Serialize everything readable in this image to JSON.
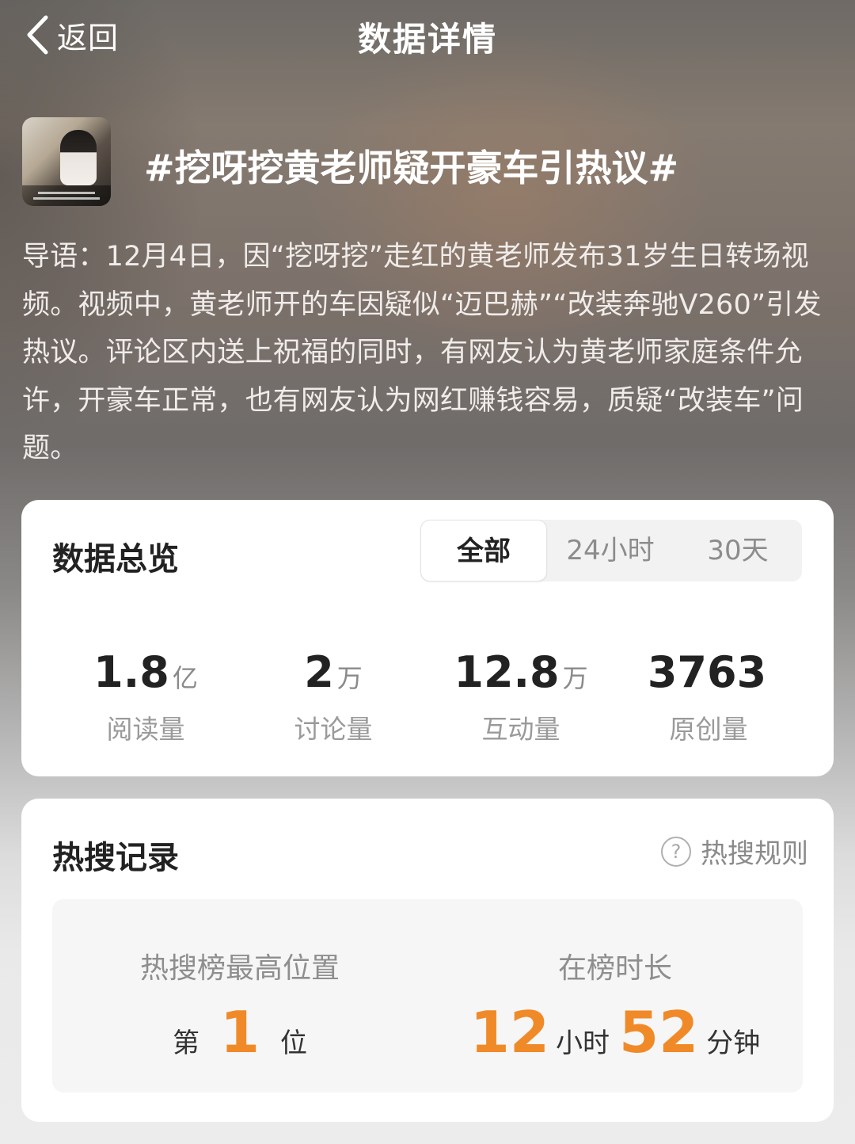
{
  "header": {
    "back_label": "返回",
    "title": "数据详情"
  },
  "topic": {
    "title": "#挖呀挖黄老师疑开豪车引热议#",
    "intro": "导语：12月4日，因“挖呀挖”走红的黄老师发布31岁生日转场视频。视频中，黄老师开的车因疑似“迈巴赫”“改装奔驰V260”引发热议。评论区内送上祝福的同时，有网友认为黄老师家庭条件允许，开豪车正常，也有网友认为网红赚钱容易，质疑“改装车”问题。"
  },
  "overview": {
    "title": "数据总览",
    "tabs": [
      {
        "label": "全部",
        "active": true
      },
      {
        "label": "24小时",
        "active": false
      },
      {
        "label": "30天",
        "active": false
      }
    ],
    "stats": [
      {
        "value": "1.8",
        "unit": "亿",
        "label": "阅读量"
      },
      {
        "value": "2",
        "unit": "万",
        "label": "讨论量"
      },
      {
        "value": "12.8",
        "unit": "万",
        "label": "互动量"
      },
      {
        "value": "3763",
        "unit": "",
        "label": "原创量"
      }
    ]
  },
  "hot": {
    "title": "热搜记录",
    "rule_label": "热搜规则",
    "rule_icon": "question-circle-icon",
    "highest": {
      "label": "热搜榜最高位置",
      "prefix": "第",
      "value": "1",
      "suffix": "位"
    },
    "duration": {
      "label": "在榜时长",
      "hours": "12",
      "hours_unit": "小时",
      "minutes": "52",
      "minutes_unit": "分钟"
    },
    "accent_color": "#f08a28"
  }
}
